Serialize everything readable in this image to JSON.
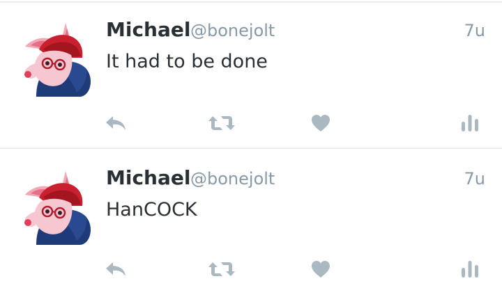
{
  "colors": {
    "name": "#292f33",
    "meta": "#8899a6",
    "icon": "#aab8c2",
    "divider": "#e6ecf0"
  },
  "tweets": [
    {
      "name": "Michael",
      "handle": "@bonejolt",
      "time": "7u",
      "text": "It had to be done",
      "avatar_icon": "fox-avatar-icon",
      "actions": [
        "reply-icon",
        "retweet-icon",
        "like-icon",
        "analytics-icon"
      ]
    },
    {
      "name": "Michael",
      "handle": "@bonejolt",
      "time": "7u",
      "text": "HanCOCK",
      "avatar_icon": "fox-avatar-icon",
      "actions": [
        "reply-icon",
        "retweet-icon",
        "like-icon",
        "analytics-icon"
      ]
    }
  ]
}
